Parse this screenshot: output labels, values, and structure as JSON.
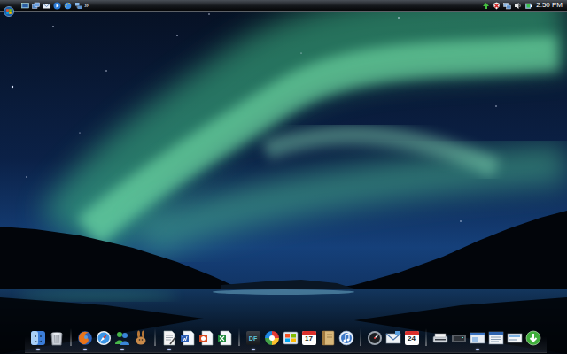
{
  "taskbar": {
    "quick_launch": [
      {
        "kind": "show-desktop"
      },
      {
        "kind": "switch-windows"
      },
      {
        "kind": "mail"
      },
      {
        "kind": "media"
      },
      {
        "kind": "browser"
      },
      {
        "kind": "network"
      }
    ],
    "chevron": "»",
    "tray_icons": [
      {
        "kind": "arrow"
      },
      {
        "kind": "security-alert"
      },
      {
        "kind": "network"
      },
      {
        "kind": "volume"
      },
      {
        "kind": "power"
      }
    ],
    "clock": "2:50 PM"
  },
  "dock": {
    "items": [
      {
        "kind": "finder",
        "running": true
      },
      {
        "kind": "trash",
        "running": false
      },
      {
        "kind": "separator"
      },
      {
        "kind": "firefox",
        "running": true
      },
      {
        "kind": "compass",
        "running": false
      },
      {
        "kind": "buddy",
        "running": true
      },
      {
        "kind": "rabbit",
        "running": false
      },
      {
        "kind": "separator"
      },
      {
        "kind": "document",
        "running": true
      },
      {
        "kind": "word",
        "running": false
      },
      {
        "kind": "slides",
        "running": false
      },
      {
        "kind": "sheet",
        "running": false
      },
      {
        "kind": "separator"
      },
      {
        "kind": "text-tile",
        "label": "DF",
        "running": true
      },
      {
        "kind": "colorwheel",
        "running": false
      },
      {
        "kind": "pictures",
        "running": false
      },
      {
        "kind": "calendar",
        "label": "17",
        "running": false
      },
      {
        "kind": "notebook",
        "running": false
      },
      {
        "kind": "music",
        "running": false
      },
      {
        "kind": "separator"
      },
      {
        "kind": "dial",
        "running": false
      },
      {
        "kind": "mail",
        "running": false
      },
      {
        "kind": "calendar",
        "label": "24",
        "running": false
      },
      {
        "kind": "separator"
      },
      {
        "kind": "scanner",
        "running": false
      },
      {
        "kind": "box",
        "running": false
      },
      {
        "kind": "window",
        "running": true
      },
      {
        "kind": "window-list",
        "running": false
      },
      {
        "kind": "panel",
        "running": false
      },
      {
        "kind": "download",
        "running": false
      }
    ]
  }
}
